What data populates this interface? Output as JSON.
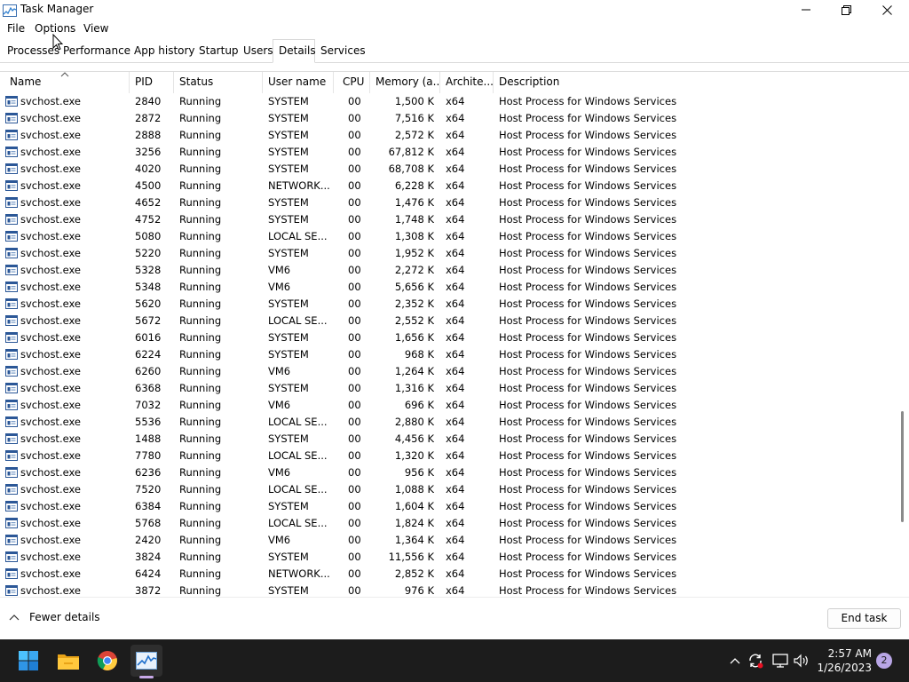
{
  "window": {
    "title": "Task Manager"
  },
  "menu": [
    "File",
    "Options",
    "View"
  ],
  "tabs": [
    {
      "label": "Processes"
    },
    {
      "label": "Performance"
    },
    {
      "label": "App history"
    },
    {
      "label": "Startup"
    },
    {
      "label": "Users"
    },
    {
      "label": "Details"
    },
    {
      "label": "Services"
    }
  ],
  "active_tab": "Details",
  "columns": {
    "name": "Name",
    "pid": "PID",
    "status": "Status",
    "user": "User name",
    "cpu": "CPU",
    "memory": "Memory (a...",
    "arch": "Archite...",
    "desc": "Description"
  },
  "rows": [
    {
      "name": "svchost.exe",
      "pid": "2840",
      "status": "Running",
      "user": "SYSTEM",
      "cpu": "00",
      "memory": "1,500 K",
      "arch": "x64",
      "desc": "Host Process for Windows Services"
    },
    {
      "name": "svchost.exe",
      "pid": "2872",
      "status": "Running",
      "user": "SYSTEM",
      "cpu": "00",
      "memory": "7,516 K",
      "arch": "x64",
      "desc": "Host Process for Windows Services"
    },
    {
      "name": "svchost.exe",
      "pid": "2888",
      "status": "Running",
      "user": "SYSTEM",
      "cpu": "00",
      "memory": "2,572 K",
      "arch": "x64",
      "desc": "Host Process for Windows Services"
    },
    {
      "name": "svchost.exe",
      "pid": "3256",
      "status": "Running",
      "user": "SYSTEM",
      "cpu": "00",
      "memory": "67,812 K",
      "arch": "x64",
      "desc": "Host Process for Windows Services"
    },
    {
      "name": "svchost.exe",
      "pid": "4020",
      "status": "Running",
      "user": "SYSTEM",
      "cpu": "00",
      "memory": "68,708 K",
      "arch": "x64",
      "desc": "Host Process for Windows Services"
    },
    {
      "name": "svchost.exe",
      "pid": "4500",
      "status": "Running",
      "user": "NETWORK...",
      "cpu": "00",
      "memory": "6,228 K",
      "arch": "x64",
      "desc": "Host Process for Windows Services"
    },
    {
      "name": "svchost.exe",
      "pid": "4652",
      "status": "Running",
      "user": "SYSTEM",
      "cpu": "00",
      "memory": "1,476 K",
      "arch": "x64",
      "desc": "Host Process for Windows Services"
    },
    {
      "name": "svchost.exe",
      "pid": "4752",
      "status": "Running",
      "user": "SYSTEM",
      "cpu": "00",
      "memory": "1,748 K",
      "arch": "x64",
      "desc": "Host Process for Windows Services"
    },
    {
      "name": "svchost.exe",
      "pid": "5080",
      "status": "Running",
      "user": "LOCAL SE...",
      "cpu": "00",
      "memory": "1,308 K",
      "arch": "x64",
      "desc": "Host Process for Windows Services"
    },
    {
      "name": "svchost.exe",
      "pid": "5220",
      "status": "Running",
      "user": "SYSTEM",
      "cpu": "00",
      "memory": "1,952 K",
      "arch": "x64",
      "desc": "Host Process for Windows Services"
    },
    {
      "name": "svchost.exe",
      "pid": "5328",
      "status": "Running",
      "user": "VM6",
      "cpu": "00",
      "memory": "2,272 K",
      "arch": "x64",
      "desc": "Host Process for Windows Services"
    },
    {
      "name": "svchost.exe",
      "pid": "5348",
      "status": "Running",
      "user": "VM6",
      "cpu": "00",
      "memory": "5,656 K",
      "arch": "x64",
      "desc": "Host Process for Windows Services"
    },
    {
      "name": "svchost.exe",
      "pid": "5620",
      "status": "Running",
      "user": "SYSTEM",
      "cpu": "00",
      "memory": "2,352 K",
      "arch": "x64",
      "desc": "Host Process for Windows Services"
    },
    {
      "name": "svchost.exe",
      "pid": "5672",
      "status": "Running",
      "user": "LOCAL SE...",
      "cpu": "00",
      "memory": "2,552 K",
      "arch": "x64",
      "desc": "Host Process for Windows Services"
    },
    {
      "name": "svchost.exe",
      "pid": "6016",
      "status": "Running",
      "user": "SYSTEM",
      "cpu": "00",
      "memory": "1,656 K",
      "arch": "x64",
      "desc": "Host Process for Windows Services"
    },
    {
      "name": "svchost.exe",
      "pid": "6224",
      "status": "Running",
      "user": "SYSTEM",
      "cpu": "00",
      "memory": "968 K",
      "arch": "x64",
      "desc": "Host Process for Windows Services"
    },
    {
      "name": "svchost.exe",
      "pid": "6260",
      "status": "Running",
      "user": "VM6",
      "cpu": "00",
      "memory": "1,264 K",
      "arch": "x64",
      "desc": "Host Process for Windows Services"
    },
    {
      "name": "svchost.exe",
      "pid": "6368",
      "status": "Running",
      "user": "SYSTEM",
      "cpu": "00",
      "memory": "1,316 K",
      "arch": "x64",
      "desc": "Host Process for Windows Services"
    },
    {
      "name": "svchost.exe",
      "pid": "7032",
      "status": "Running",
      "user": "VM6",
      "cpu": "00",
      "memory": "696 K",
      "arch": "x64",
      "desc": "Host Process for Windows Services"
    },
    {
      "name": "svchost.exe",
      "pid": "5536",
      "status": "Running",
      "user": "LOCAL SE...",
      "cpu": "00",
      "memory": "2,880 K",
      "arch": "x64",
      "desc": "Host Process for Windows Services"
    },
    {
      "name": "svchost.exe",
      "pid": "1488",
      "status": "Running",
      "user": "SYSTEM",
      "cpu": "00",
      "memory": "4,456 K",
      "arch": "x64",
      "desc": "Host Process for Windows Services"
    },
    {
      "name": "svchost.exe",
      "pid": "7780",
      "status": "Running",
      "user": "LOCAL SE...",
      "cpu": "00",
      "memory": "1,320 K",
      "arch": "x64",
      "desc": "Host Process for Windows Services"
    },
    {
      "name": "svchost.exe",
      "pid": "6236",
      "status": "Running",
      "user": "VM6",
      "cpu": "00",
      "memory": "956 K",
      "arch": "x64",
      "desc": "Host Process for Windows Services"
    },
    {
      "name": "svchost.exe",
      "pid": "7520",
      "status": "Running",
      "user": "LOCAL SE...",
      "cpu": "00",
      "memory": "1,088 K",
      "arch": "x64",
      "desc": "Host Process for Windows Services"
    },
    {
      "name": "svchost.exe",
      "pid": "6384",
      "status": "Running",
      "user": "SYSTEM",
      "cpu": "00",
      "memory": "1,604 K",
      "arch": "x64",
      "desc": "Host Process for Windows Services"
    },
    {
      "name": "svchost.exe",
      "pid": "5768",
      "status": "Running",
      "user": "LOCAL SE...",
      "cpu": "00",
      "memory": "1,824 K",
      "arch": "x64",
      "desc": "Host Process for Windows Services"
    },
    {
      "name": "svchost.exe",
      "pid": "2420",
      "status": "Running",
      "user": "VM6",
      "cpu": "00",
      "memory": "1,364 K",
      "arch": "x64",
      "desc": "Host Process for Windows Services"
    },
    {
      "name": "svchost.exe",
      "pid": "3824",
      "status": "Running",
      "user": "SYSTEM",
      "cpu": "00",
      "memory": "11,556 K",
      "arch": "x64",
      "desc": "Host Process for Windows Services"
    },
    {
      "name": "svchost.exe",
      "pid": "6424",
      "status": "Running",
      "user": "NETWORK...",
      "cpu": "00",
      "memory": "2,852 K",
      "arch": "x64",
      "desc": "Host Process for Windows Services"
    },
    {
      "name": "svchost.exe",
      "pid": "3872",
      "status": "Running",
      "user": "SYSTEM",
      "cpu": "00",
      "memory": "976 K",
      "arch": "x64",
      "desc": "Host Process for Windows Services"
    }
  ],
  "footer": {
    "fewer_details": "Fewer details",
    "end_task": "End task"
  },
  "taskbar": {
    "apps": [
      "start-icon",
      "file-explorer-icon",
      "chrome-icon",
      "task-manager-icon"
    ],
    "time": "2:57 AM",
    "date": "1/26/2023",
    "notification_count": "2"
  },
  "colors": {
    "taskbar_bg": "#1c1c1c",
    "accent": "#0067c0",
    "notif_badge": "#b9a6e6"
  }
}
